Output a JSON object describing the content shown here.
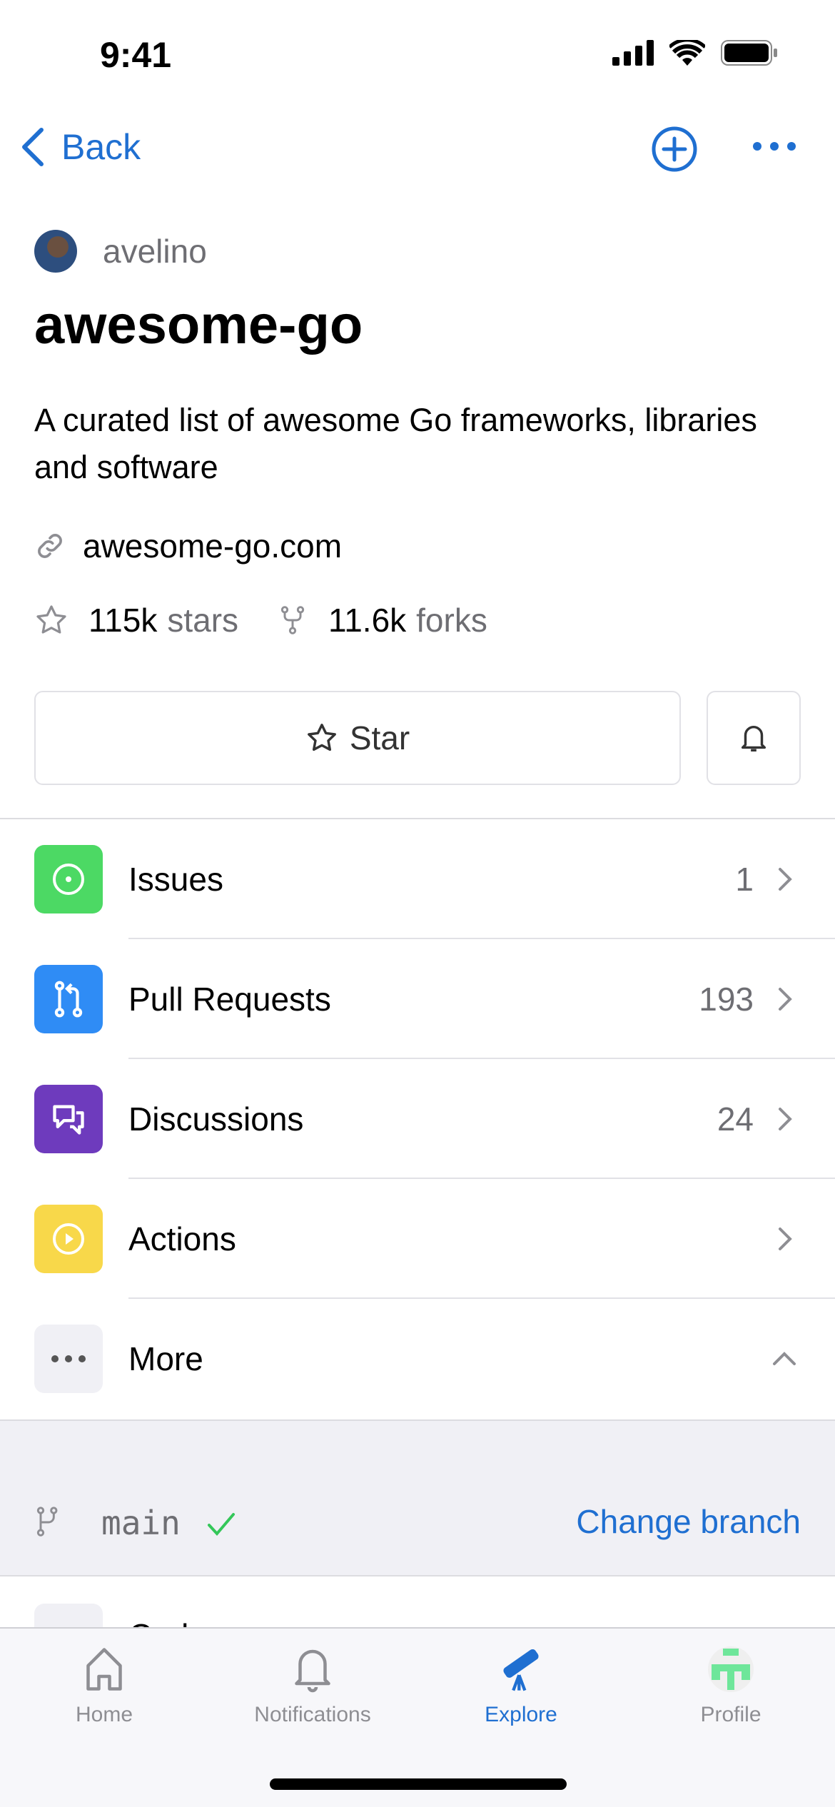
{
  "status_bar": {
    "time": "9:41"
  },
  "nav": {
    "back_label": "Back"
  },
  "repo": {
    "owner": "avelino",
    "name": "awesome-go",
    "description": "A curated list of awesome Go frameworks, libraries and software",
    "website": "awesome-go.com",
    "stars_count": "115k",
    "stars_label": "stars",
    "forks_count": "11.6k",
    "forks_label": "forks"
  },
  "actions": {
    "star_label": "Star"
  },
  "menu": [
    {
      "label": "Issues",
      "count": "1",
      "color": "#4cd964"
    },
    {
      "label": "Pull Requests",
      "count": "193",
      "color": "#2f8cf5"
    },
    {
      "label": "Discussions",
      "count": "24",
      "color": "#6e3bbd"
    },
    {
      "label": "Actions",
      "count": "",
      "color": "#f8d84a"
    },
    {
      "label": "More",
      "count": "",
      "color": "#f0f0f5"
    }
  ],
  "branch": {
    "name": "main",
    "change_label": "Change branch"
  },
  "partial_row": {
    "label": "Code"
  },
  "tabs": [
    {
      "label": "Home"
    },
    {
      "label": "Notifications"
    },
    {
      "label": "Explore",
      "active": true
    },
    {
      "label": "Profile"
    }
  ],
  "colors": {
    "accent": "#1f6fd1",
    "success": "#34c759"
  }
}
